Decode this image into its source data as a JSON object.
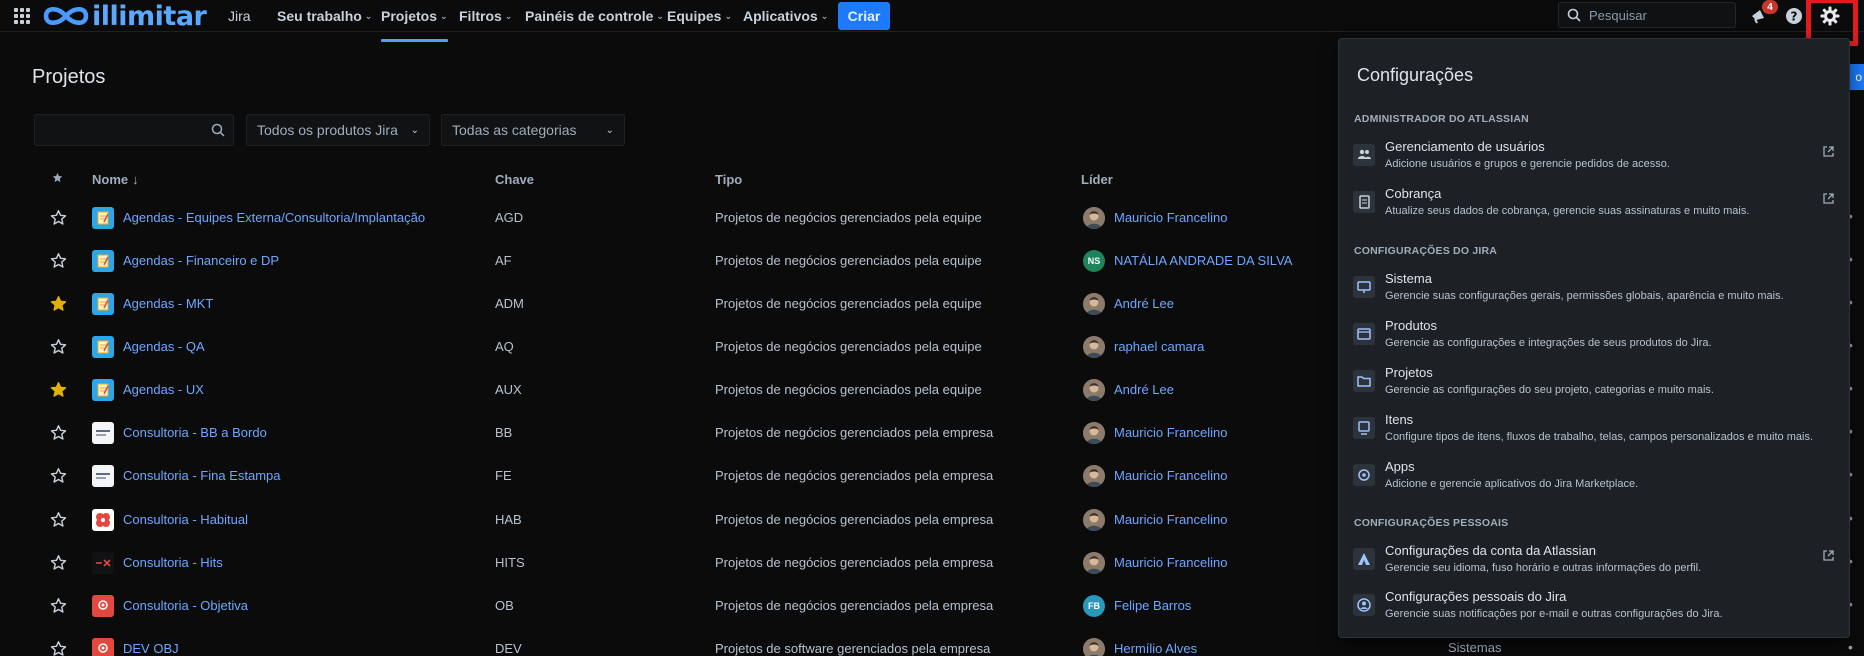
{
  "nav": {
    "logo_text": "illimitar",
    "product": "Jira",
    "items": [
      {
        "label": "Seu trabalho"
      },
      {
        "label": "Projetos"
      },
      {
        "label": "Filtros"
      },
      {
        "label": "Painéis de controle"
      },
      {
        "label": "Equipes"
      },
      {
        "label": "Aplicativos"
      }
    ],
    "create_label": "Criar",
    "search_placeholder": "Pesquisar",
    "notifications_count": "4"
  },
  "page": {
    "title": "Projetos",
    "filters": {
      "search_value": "",
      "product_select": "Todos os produtos Jira",
      "category_select": "Todas as categorias"
    },
    "right_edge_button": "o",
    "columns": {
      "name": "Nome",
      "sort_indicator": "↓",
      "key": "Chave",
      "type": "Tipo",
      "lead": "Líder"
    },
    "projects": [
      {
        "starred": false,
        "name": "Agendas - Equipes Externa/Consultoria/Implantação",
        "key": "AGD",
        "type": "Projetos de negócios gerenciados pela equipe",
        "lead": "Mauricio Francelino",
        "lead_initials": "",
        "icon": "note"
      },
      {
        "starred": false,
        "name": "Agendas - Financeiro e DP",
        "key": "AF",
        "type": "Projetos de negócios gerenciados pela equipe",
        "lead": "NATÁLIA ANDRADE DA SILVA",
        "lead_initials": "NS",
        "icon": "note"
      },
      {
        "starred": true,
        "name": "Agendas - MKT",
        "key": "ADM",
        "type": "Projetos de negócios gerenciados pela equipe",
        "lead": "André Lee",
        "lead_initials": "",
        "icon": "note"
      },
      {
        "starred": false,
        "name": "Agendas - QA",
        "key": "AQ",
        "type": "Projetos de negócios gerenciados pela equipe",
        "lead": "raphael camara",
        "lead_initials": "",
        "icon": "note"
      },
      {
        "starred": true,
        "name": "Agendas - UX",
        "key": "AUX",
        "type": "Projetos de negócios gerenciados pela equipe",
        "lead": "André Lee",
        "lead_initials": "",
        "icon": "note"
      },
      {
        "starred": false,
        "name": "Consultoria - BB a Bordo",
        "key": "BB",
        "type": "Projetos de negócios gerenciados pela empresa",
        "lead": "Mauricio Francelino",
        "lead_initials": "",
        "icon": "white"
      },
      {
        "starred": false,
        "name": "Consultoria - Fina Estampa",
        "key": "FE",
        "type": "Projetos de negócios gerenciados pela empresa",
        "lead": "Mauricio Francelino",
        "lead_initials": "",
        "icon": "white"
      },
      {
        "starred": false,
        "name": "Consultoria - Habitual",
        "key": "HAB",
        "type": "Projetos de negócios gerenciados pela empresa",
        "lead": "Mauricio Francelino",
        "lead_initials": "",
        "icon": "red-flower"
      },
      {
        "starred": false,
        "name": "Consultoria - Hits",
        "key": "HITS",
        "type": "Projetos de negócios gerenciados pela empresa",
        "lead": "Mauricio Francelino",
        "lead_initials": "",
        "icon": "dark"
      },
      {
        "starred": false,
        "name": "Consultoria - Objetiva",
        "key": "OB",
        "type": "Projetos de negócios gerenciados pela empresa",
        "lead": "Felipe Barros",
        "lead_initials": "FB",
        "icon": "red"
      },
      {
        "starred": false,
        "name": "DEV OBJ",
        "key": "DEV",
        "type": "Projetos de software gerenciados pela empresa",
        "lead": "Hermílio Alves",
        "lead_initials": "",
        "icon": "red"
      }
    ],
    "peek_text": "Sistemas"
  },
  "settings_panel": {
    "title": "Configurações",
    "sections": [
      {
        "label": "ADMINISTRADOR DO ATLASSIAN",
        "items": [
          {
            "title": "Gerenciamento de usuários",
            "desc": "Adicione usuários e grupos e gerencie pedidos de acesso.",
            "icon": "users-icon",
            "external": true
          },
          {
            "title": "Cobrança",
            "desc": "Atualize seus dados de cobrança, gerencie suas assinaturas e muito mais.",
            "icon": "billing-icon",
            "external": true
          }
        ]
      },
      {
        "label": "CONFIGURAÇÕES DO JIRA",
        "items": [
          {
            "title": "Sistema",
            "desc": "Gerencie suas configurações gerais, permissões globais, aparência e muito mais.",
            "icon": "monitor-icon",
            "external": false
          },
          {
            "title": "Produtos",
            "desc": "Gerencie as configurações e integrações de seus produtos do Jira.",
            "icon": "window-icon",
            "external": false
          },
          {
            "title": "Projetos",
            "desc": "Gerencie as configurações do seu projeto, categorias e muito mais.",
            "icon": "folder-icon",
            "external": false
          },
          {
            "title": "Itens",
            "desc": "Configure tipos de itens, fluxos de trabalho, telas, campos personalizados e muito mais.",
            "icon": "issues-icon",
            "external": false
          },
          {
            "title": "Apps",
            "desc": "Adicione e gerencie aplicativos do Jira Marketplace.",
            "icon": "apps-icon",
            "external": false
          }
        ]
      },
      {
        "label": "CONFIGURAÇÕES PESSOAIS",
        "items": [
          {
            "title": "Configurações da conta da Atlassian",
            "desc": "Gerencie seu idioma, fuso horário e outras informações do perfil.",
            "icon": "atlassian-icon",
            "external": true
          },
          {
            "title": "Configurações pessoais do Jira",
            "desc": "Gerencie suas notificações por e-mail e outras configurações do Jira.",
            "icon": "person-icon",
            "external": false
          }
        ]
      }
    ]
  },
  "colors": {
    "background": "#0b0b0c",
    "link": "#6ea7ff",
    "primary": "#1d7afc",
    "star_filled": "#e2b203",
    "highlight": "#e31b1b"
  }
}
